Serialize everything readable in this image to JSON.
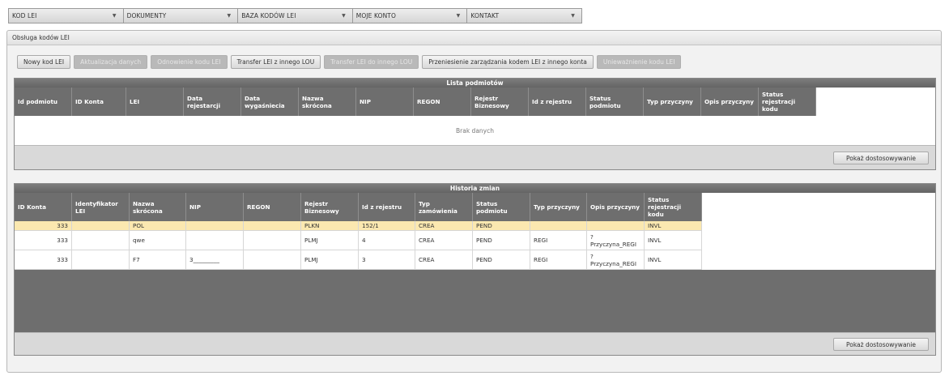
{
  "menu": [
    {
      "label": "KOD LEI"
    },
    {
      "label": "DOKUMENTY"
    },
    {
      "label": "BAZA KODÓW LEI"
    },
    {
      "label": "MOJE KONTO"
    },
    {
      "label": "KONTAKT"
    }
  ],
  "panel": {
    "title": "Obsługa kodów LEI"
  },
  "toolbar": [
    {
      "label": "Nowy kod LEI",
      "enabled": true
    },
    {
      "label": "Aktualizacja danych",
      "enabled": false
    },
    {
      "label": "Odnowienie kodu LEI",
      "enabled": false
    },
    {
      "label": "Transfer LEI z innego LOU",
      "enabled": true
    },
    {
      "label": "Transfer LEI do innego LOU",
      "enabled": false
    },
    {
      "label": "Przeniesienie zarządzania kodem LEI z innego konta",
      "enabled": true
    },
    {
      "label": "Unieważnienie kodu LEI",
      "enabled": false
    }
  ],
  "entities": {
    "title": "Lista podmiotów",
    "columns": [
      "Id podmiotu",
      "ID Konta",
      "LEI",
      "Data rejestarcji",
      "Data wygaśniecia",
      "Nazwa skrócona",
      "NIP",
      "REGON",
      "Rejestr Biznesowy",
      "Id z rejestru",
      "Status podmiotu",
      "Typ przyczyny",
      "Opis przyczyny",
      "Status rejestracji kodu"
    ],
    "empty_text": "Brak danych",
    "footer_button": "Pokaż dostosowywanie"
  },
  "history": {
    "title": "Historia zmian",
    "columns": [
      "ID Konta",
      "Identyfikator LEI",
      "Nazwa skrócona",
      "NIP",
      "REGON",
      "Rejestr Biznesowy",
      "Id z rejestru",
      "Typ zamówienia",
      "Status podmiotu",
      "Typ przyczyny",
      "Opis przyczyny",
      "Status rejestracji kodu"
    ],
    "rows": [
      [
        "333",
        "",
        "POL",
        "",
        "",
        "PLKN",
        "152/1",
        "CREA",
        "PEND",
        "",
        "",
        "INVL"
      ],
      [
        "333",
        "",
        "qwe",
        "",
        "",
        "PLMJ",
        "4",
        "CREA",
        "PEND",
        "REGI",
        "? Przyczyna_REGI",
        "INVL"
      ],
      [
        "333",
        "",
        "F7",
        "3_________",
        "",
        "PLMJ",
        "3",
        "CREA",
        "PEND",
        "REGI",
        "? Przyczyna_REGI",
        "INVL"
      ]
    ],
    "footer_button": "Pokaż dostosowywanie"
  }
}
